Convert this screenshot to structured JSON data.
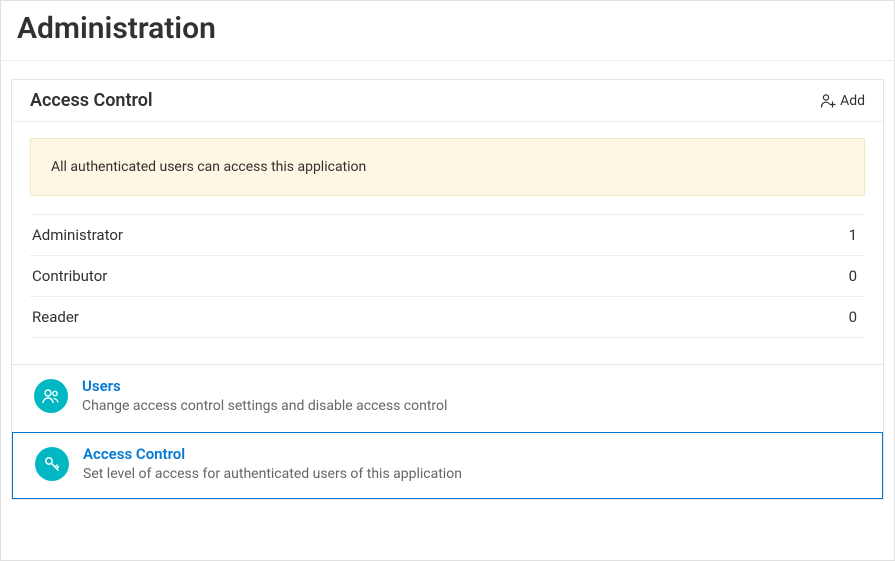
{
  "page": {
    "title": "Administration"
  },
  "panel": {
    "title": "Access Control",
    "add_label": "Add",
    "banner": "All authenticated users can access this application",
    "roles": [
      {
        "name": "Administrator",
        "count": "1"
      },
      {
        "name": "Contributor",
        "count": "0"
      },
      {
        "name": "Reader",
        "count": "0"
      }
    ],
    "nav": {
      "users": {
        "title": "Users",
        "desc": "Change access control settings and disable access control"
      },
      "access": {
        "title": "Access Control",
        "desc": "Set level of access for authenticated users of this application"
      }
    }
  }
}
